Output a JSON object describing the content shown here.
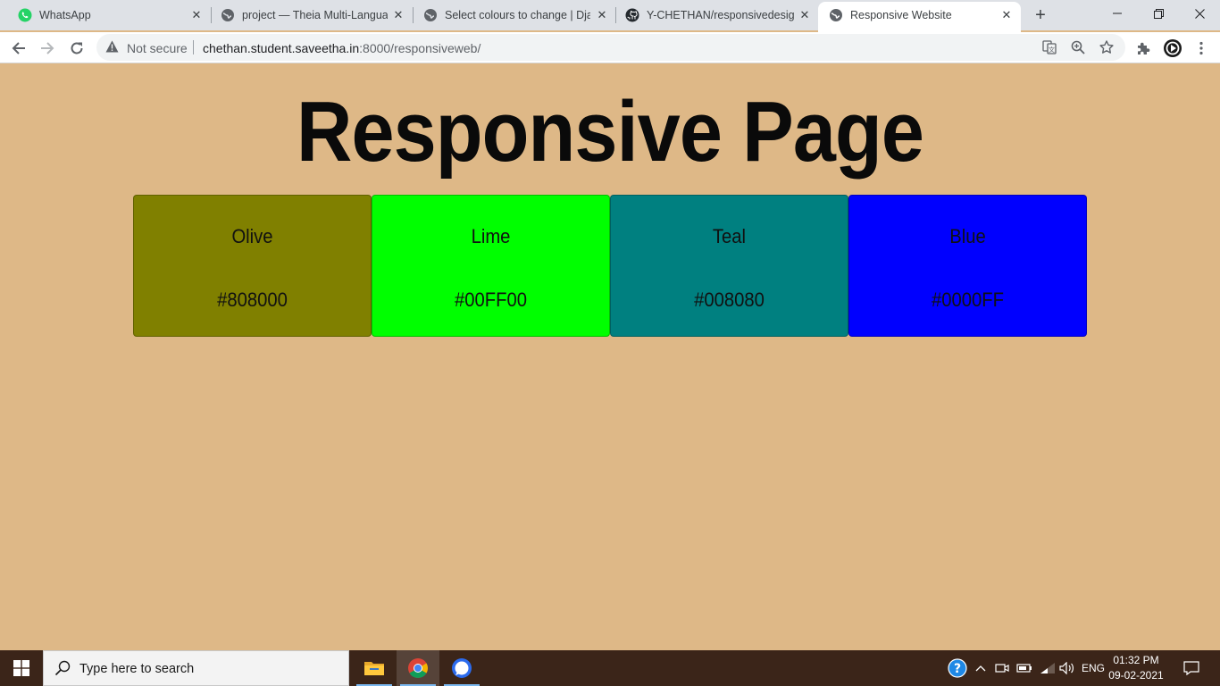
{
  "browser": {
    "tabs": [
      {
        "title": "WhatsApp",
        "icon": "whatsapp-icon",
        "active": false
      },
      {
        "title": "project — Theia Multi-Languag",
        "icon": "globe-icon",
        "active": false
      },
      {
        "title": "Select colours to change | Djan",
        "icon": "globe-icon",
        "active": false
      },
      {
        "title": "Y-CHETHAN/responsivedesign",
        "icon": "github-icon",
        "active": false
      },
      {
        "title": "Responsive Website",
        "icon": "globe-icon",
        "active": true
      }
    ],
    "new_tab_symbol": "+",
    "security_label": "Not secure",
    "url_host": "chethan.student.saveetha.in",
    "url_rest": ":8000/responsiveweb/"
  },
  "page": {
    "title": "Responsive Page",
    "background": "#DEB887",
    "swatches": [
      {
        "name": "Olive",
        "hex": "#808000",
        "color": "#808000"
      },
      {
        "name": "Lime",
        "hex": "#00FF00",
        "color": "#00FF00"
      },
      {
        "name": "Teal",
        "hex": "#008080",
        "color": "#008080"
      },
      {
        "name": "Blue",
        "hex": "#0000FF",
        "color": "#0000FF"
      }
    ]
  },
  "taskbar": {
    "search_placeholder": "Type here to search",
    "language": "ENG",
    "time": "01:32 PM",
    "date": "09-02-2021"
  }
}
